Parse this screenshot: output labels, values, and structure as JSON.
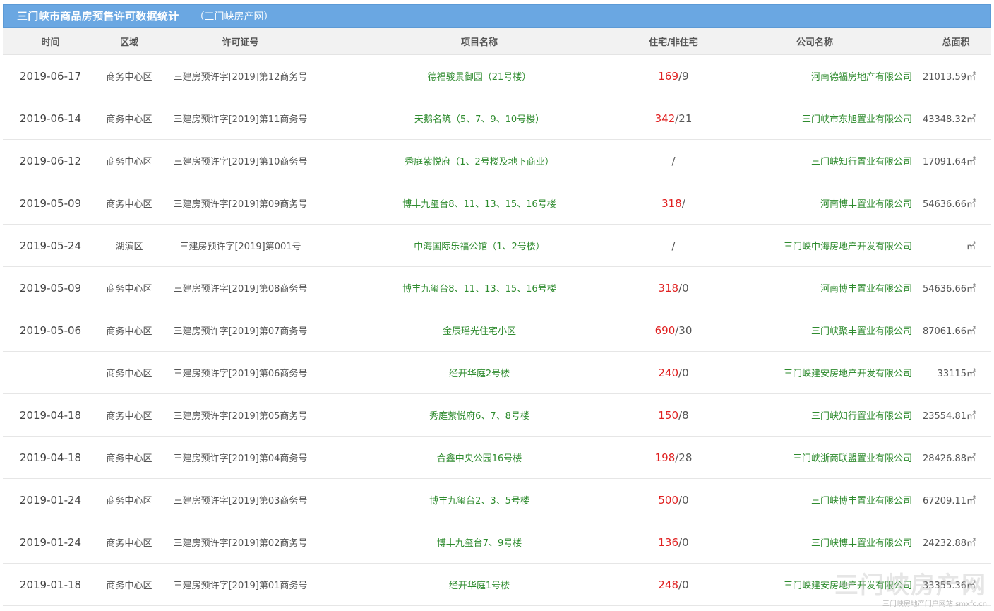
{
  "header": {
    "title": "三门峡市商品房预售许可数据统计",
    "subtitle": "（三门峡房产网）"
  },
  "columns": [
    "时间",
    "区域",
    "许可证号",
    "项目名称",
    "住宅/非住宅",
    "公司名称",
    "总面积"
  ],
  "rows": [
    {
      "date": "2019-06-17",
      "area": "商务中心区",
      "permit": "三建房预许字[2019]第12商务号",
      "project": "德福骏景御园（21号楼）",
      "res": "169",
      "nonres": "/9",
      "company": "河南德福房地产有限公司",
      "total": "21013.59㎡"
    },
    {
      "date": "2019-06-14",
      "area": "商务中心区",
      "permit": "三建房预许字[2019]第11商务号",
      "project": "天鹅名筑（5、7、9、10号楼）",
      "res": "342",
      "nonres": "/21",
      "company": "三门峡市东旭置业有限公司",
      "total": "43348.32㎡"
    },
    {
      "date": "2019-06-12",
      "area": "商务中心区",
      "permit": "三建房预许字[2019]第10商务号",
      "project": "秀庭紫悦府（1、2号楼及地下商业）",
      "res": "",
      "nonres": "/",
      "company": "三门峡知行置业有限公司",
      "total": "17091.64㎡"
    },
    {
      "date": "2019-05-09",
      "area": "商务中心区",
      "permit": "三建房预许字[2019]第09商务号",
      "project": "博丰九玺台8、11、13、15、16号楼",
      "res": "318",
      "nonres": "/",
      "company": "河南博丰置业有限公司",
      "total": "54636.66㎡"
    },
    {
      "date": "2019-05-24",
      "area": "湖滨区",
      "permit": "三建房预许字[2019]第001号",
      "project": "中海国际乐福公馆（1、2号楼）",
      "res": "",
      "nonres": "/",
      "company": "三门峡中海房地产开发有限公司",
      "total": "㎡"
    },
    {
      "date": "2019-05-09",
      "area": "商务中心区",
      "permit": "三建房预许字[2019]第08商务号",
      "project": "博丰九玺台8、11、13、15、16号楼",
      "res": "318",
      "nonres": "/0",
      "company": "河南博丰置业有限公司",
      "total": "54636.66㎡"
    },
    {
      "date": "2019-05-06",
      "area": "商务中心区",
      "permit": "三建房预许字[2019]第07商务号",
      "project": "金辰瑶光住宅小区",
      "res": "690",
      "nonres": "/30",
      "company": "三门峡聚丰置业有限公司",
      "total": "87061.66㎡"
    },
    {
      "date": "",
      "area": "商务中心区",
      "permit": "三建房预许字[2019]第06商务号",
      "project": "经开华庭2号楼",
      "res": "240",
      "nonres": "/0",
      "company": "三门峡建安房地产开发有限公司",
      "total": "33115㎡"
    },
    {
      "date": "2019-04-18",
      "area": "商务中心区",
      "permit": "三建房预许字[2019]第05商务号",
      "project": "秀庭紫悦府6、7、8号楼",
      "res": "150",
      "nonres": "/8",
      "company": "三门峡知行置业有限公司",
      "total": "23554.81㎡"
    },
    {
      "date": "2019-04-18",
      "area": "商务中心区",
      "permit": "三建房预许字[2019]第04商务号",
      "project": "合鑫中央公园16号楼",
      "res": "198",
      "nonres": "/28",
      "company": "三门峡浙商联盟置业有限公司",
      "total": "28426.88㎡"
    },
    {
      "date": "2019-01-24",
      "area": "商务中心区",
      "permit": "三建房预许字[2019]第03商务号",
      "project": "博丰九玺台2、3、5号楼",
      "res": "500",
      "nonres": "/0",
      "company": "三门峡博丰置业有限公司",
      "total": "67209.11㎡"
    },
    {
      "date": "2019-01-24",
      "area": "商务中心区",
      "permit": "三建房预许字[2019]第02商务号",
      "project": "博丰九玺台7、9号楼",
      "res": "136",
      "nonres": "/0",
      "company": "三门峡博丰置业有限公司",
      "total": "24232.88㎡"
    },
    {
      "date": "2019-01-18",
      "area": "商务中心区",
      "permit": "三建房预许字[2019]第01商务号",
      "project": "经开华庭1号楼",
      "res": "248",
      "nonres": "/0",
      "company": "三门峡建安房地产开发有限公司",
      "total": "33355.36㎡"
    }
  ],
  "watermark": {
    "logo": "三门峡房产网",
    "tagline": "三门峡房地产门户网站 smxfc.cn"
  }
}
